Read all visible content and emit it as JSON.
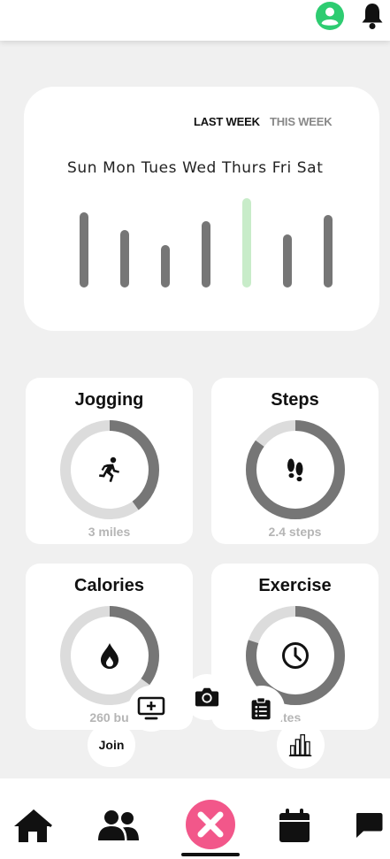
{
  "header": {
    "profile_icon": "user-circle-icon",
    "notification_icon": "bell-icon",
    "accent": "#2ecc71"
  },
  "week_chart": {
    "tabs": [
      {
        "label": "LAST WEEK",
        "active": true
      },
      {
        "label": "THIS WEEK",
        "active": false
      }
    ],
    "days_label": "Sun Mon Tues Wed Thurs Fri Sat",
    "chart_data": {
      "type": "bar",
      "categories": [
        "Sun",
        "Mon",
        "Tues",
        "Wed",
        "Thurs",
        "Fri",
        "Sat"
      ],
      "values": [
        85,
        65,
        48,
        75,
        101,
        60,
        82
      ],
      "highlight_index": 4,
      "bar_color": "#767676",
      "highlight_color": "#c8ecc9"
    }
  },
  "stats": [
    {
      "title": "Jogging",
      "value": "3 miles",
      "icon": "running-person-icon",
      "progress": 0.4
    },
    {
      "title": "Steps",
      "value": "2.4 steps",
      "icon": "footprints-icon",
      "progress": 0.85
    },
    {
      "title": "Calories",
      "value": "260 bu",
      "icon": "flame-drop-icon",
      "progress": 0.35
    },
    {
      "title": "Exercise",
      "value": "inutes",
      "icon": "clock-icon",
      "progress": 0.8
    }
  ],
  "fab_menu": {
    "join_label": "Join",
    "icons": [
      "screen-add-icon",
      "camera-icon",
      "clipboard-list-icon",
      "bar-chart-icon"
    ]
  },
  "bottom_nav": {
    "items": [
      "home-icon",
      "users-icon",
      "close-icon",
      "calendar-icon",
      "chat-icon"
    ],
    "center_color": "#f2578a"
  }
}
